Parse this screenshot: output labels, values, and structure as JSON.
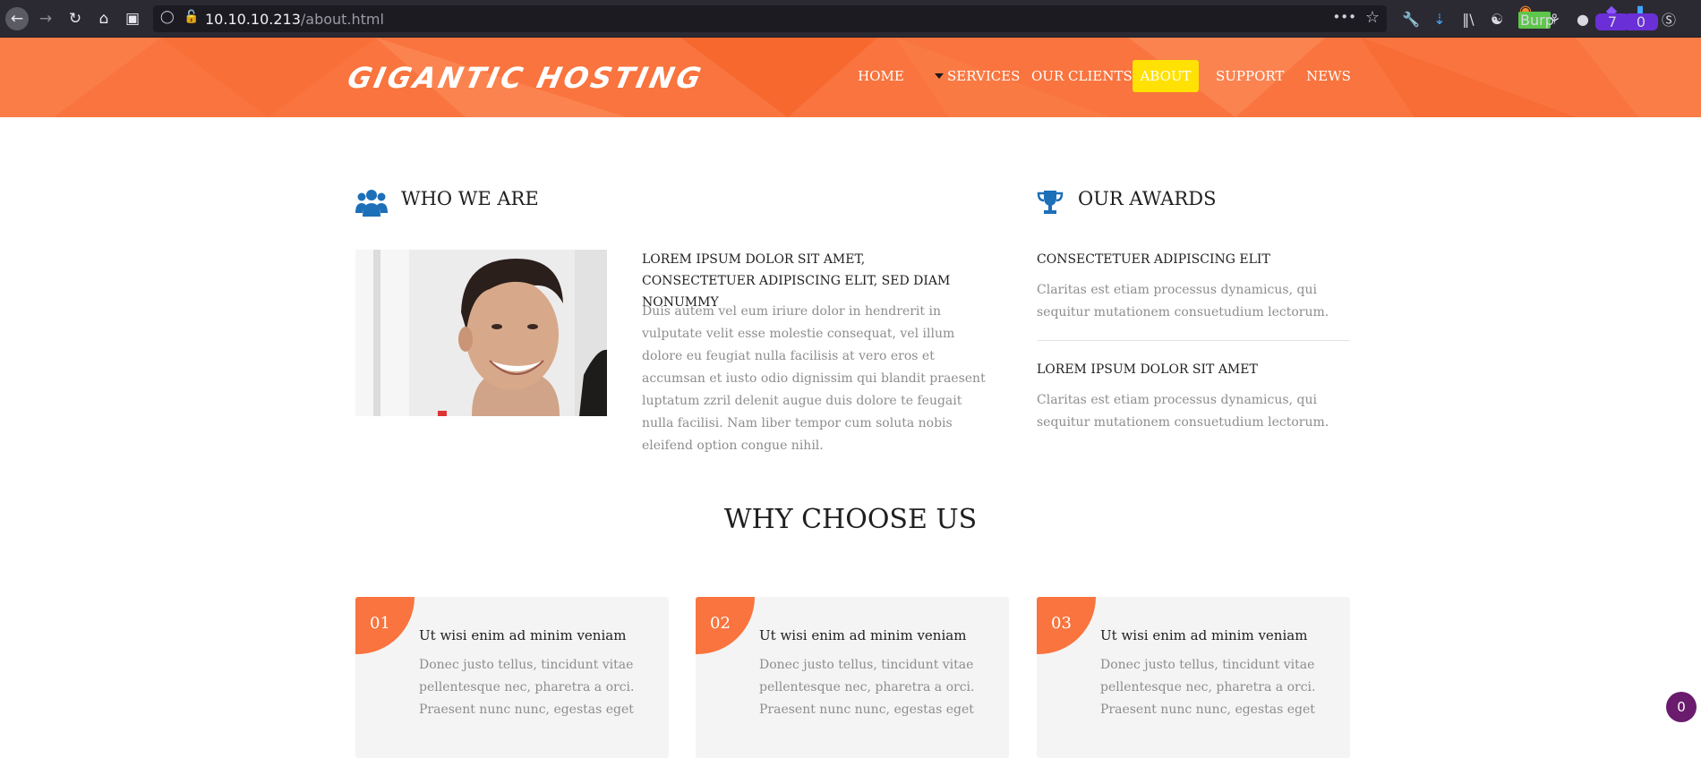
{
  "browser": {
    "url_host": "10.10.10.213",
    "url_path": "/about.html",
    "burp_label": "Burp",
    "badge_7": "7",
    "badge_0": "0"
  },
  "header": {
    "logo": "GIGANTIC HOSTING",
    "nav": [
      {
        "label": "HOME"
      },
      {
        "label": "SERVICES"
      },
      {
        "label": "OUR CLIENTS"
      },
      {
        "label": "ABOUT",
        "active": true
      },
      {
        "label": "SUPPORT"
      },
      {
        "label": "NEWS"
      }
    ]
  },
  "who_we_are": {
    "title": "WHO WE ARE",
    "subhead": "LOREM IPSUM DOLOR SIT AMET, CONSECTETUER ADIPISCING ELIT, SED DIAM NONUMMY",
    "text": "Duis autem vel eum iriure dolor in hendrerit in vulputate velit esse molestie consequat, vel illum dolore eu feugiat nulla facilisis at vero eros et accumsan et iusto odio dignissim qui blandit praesent luptatum zzril delenit augue duis dolore te feugait nulla facilisi. Nam liber tempor cum soluta nobis eleifend option congue nihil."
  },
  "awards": {
    "title": "OUR AWARDS",
    "items": [
      {
        "title": "CONSECTETUER ADIPISCING ELIT",
        "text": "Claritas est etiam processus dynamicus, qui sequitur mutationem consuetudium lectorum."
      },
      {
        "title": "LOREM IPSUM DOLOR SIT AMET",
        "text": "Claritas est etiam processus dynamicus, qui sequitur mutationem consuetudium lectorum."
      }
    ]
  },
  "why": {
    "title": "WHY CHOOSE US",
    "cards": [
      {
        "num": "01",
        "title": "Ut wisi enim ad minim veniam",
        "text": "Donec justo tellus, tincidunt vitae pellentesque nec, pharetra a orci. Praesent nunc nunc, egestas eget"
      },
      {
        "num": "02",
        "title": "Ut wisi enim ad minim veniam",
        "text": "Donec justo tellus, tincidunt vitae pellentesque nec, pharetra a orci. Praesent nunc nunc, egestas eget"
      },
      {
        "num": "03",
        "title": "Ut wisi enim ad minim veniam",
        "text": "Donec justo tellus, tincidunt vitae pellentesque nec, pharetra a orci. Praesent nunc nunc, egestas eget"
      }
    ]
  },
  "chat": {
    "count": "0"
  },
  "colors": {
    "accent": "#f9743e",
    "active_nav": "#ffe103",
    "icon_blue": "#1d6fb8"
  }
}
